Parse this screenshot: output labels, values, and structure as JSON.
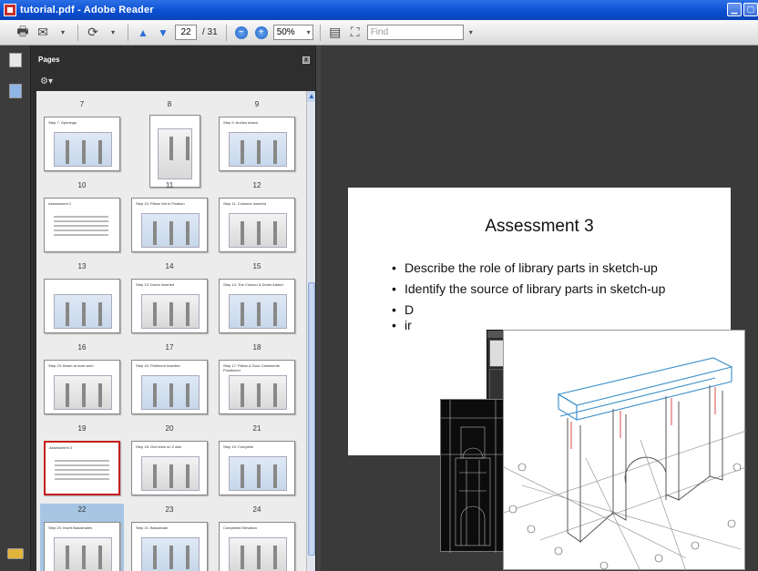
{
  "window": {
    "title": "tutorial.pdf - Adobe Reader",
    "controls": [
      "minimize",
      "maximize"
    ]
  },
  "toolbar": {
    "current_page": "22",
    "total_pages": "/ 31",
    "zoom": "50%",
    "find_placeholder": "Find"
  },
  "panel": {
    "title": "Pages"
  },
  "thumbnails": [
    {
      "num": "7",
      "label": "Step 7:  Openings"
    },
    {
      "num": "8",
      "label": ""
    },
    {
      "num": "9",
      "label": "Step 9:  Arches drawn"
    },
    {
      "num": "10",
      "label": "Assessment 2"
    },
    {
      "num": "11",
      "label": "Step 10:  Pillars Set in Position"
    },
    {
      "num": "12",
      "label": "Step 11:  Columns Inserted"
    },
    {
      "num": "13",
      "label": ""
    },
    {
      "num": "14",
      "label": "Step 13:  Dome Inserted"
    },
    {
      "num": "15",
      "label": "Step 14:  The Column & Dome Added"
    },
    {
      "num": "16",
      "label": "Step 15:  Beam at main arch"
    },
    {
      "num": "17",
      "label": "Step 16:  Pediment Inserted"
    },
    {
      "num": "18",
      "label": "Step 17:  Pillars & Door Casements Positioned"
    },
    {
      "num": "19",
      "label": "Assessment 3"
    },
    {
      "num": "20",
      "label": "Step 18:  Grid lines on Z axis"
    },
    {
      "num": "21",
      "label": "Step 19:  Complete"
    },
    {
      "num": "22",
      "label": "Step 20:  Insert Balustrades"
    },
    {
      "num": "23",
      "label": "Step 21:  Balustrade"
    },
    {
      "num": "24",
      "label": "Completed Elevation"
    }
  ],
  "slide": {
    "title": "Assessment 3",
    "bullets": [
      "Describe the role of library parts in sketch-up",
      "Identify the source of library parts in sketch-up",
      "D",
      "ir"
    ]
  }
}
